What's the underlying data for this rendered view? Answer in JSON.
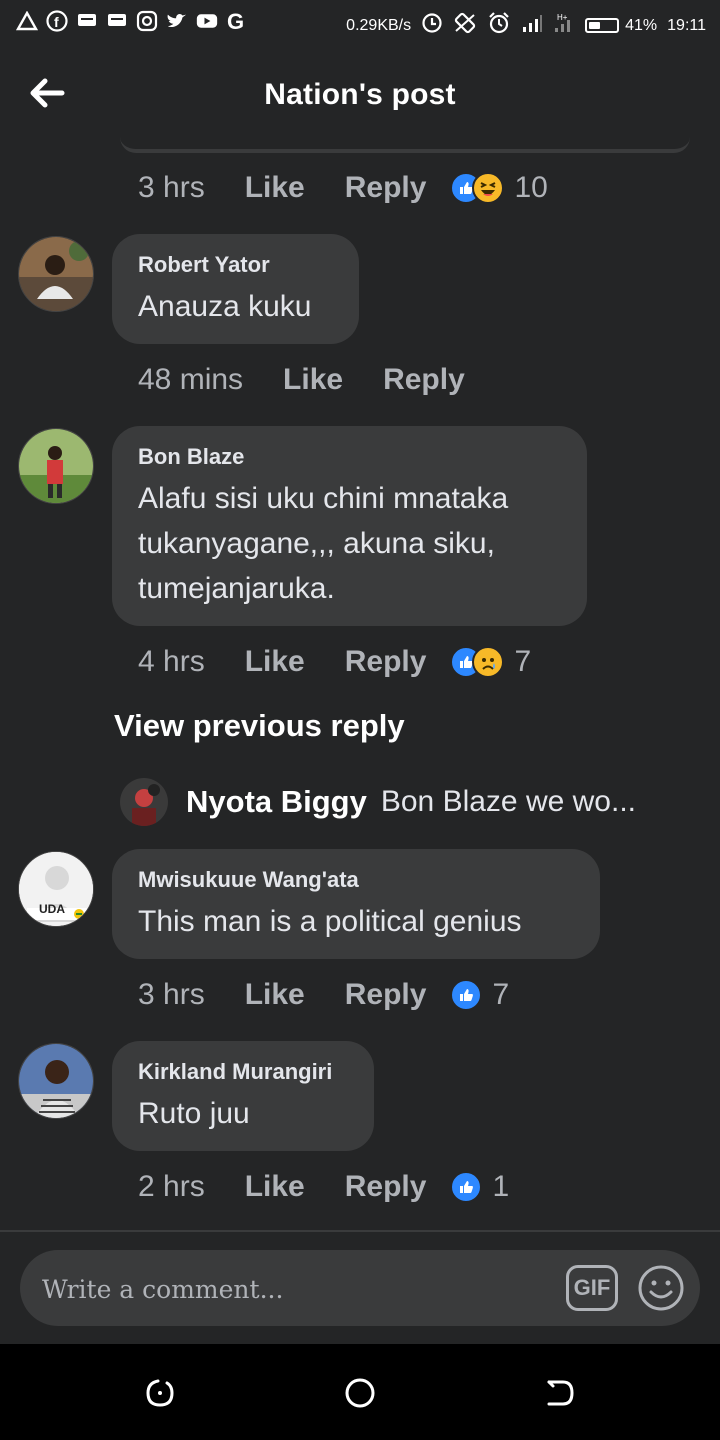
{
  "status_bar": {
    "speed": "0.29KB/s",
    "battery": "41%",
    "battery_fraction": 0.41,
    "time": "19:11",
    "left_icons": [
      "warning-icon",
      "facebook-icon",
      "message-icon",
      "message-icon",
      "instagram-icon",
      "twitter-icon",
      "youtube-icon",
      "google-icon"
    ],
    "right_icons": [
      "data-saver-icon",
      "rotate-icon",
      "alarm-icon",
      "signal-icon",
      "no-sim-signal-icon",
      "battery-icon"
    ]
  },
  "header": {
    "title": "Nation's post"
  },
  "top_comment_meta": {
    "time": "3 hrs",
    "like": "Like",
    "reply": "Reply",
    "reactions": [
      "like",
      "haha"
    ],
    "count": "10"
  },
  "comments": [
    {
      "author": "Robert Yator",
      "text": "Anauza kuku",
      "time": "48 mins",
      "like": "Like",
      "reply": "Reply",
      "reactions": [],
      "count": ""
    },
    {
      "author": "Bon Blaze",
      "text": "Alafu sisi uku chini mnataka\ntukanyagane,,, akuna siku,\ntumejanjaruka.",
      "time": "4 hrs",
      "like": "Like",
      "reply": "Reply",
      "reactions": [
        "like",
        "sad"
      ],
      "count": "7"
    },
    {
      "author": "Mwisukuue Wang'ata",
      "text": "This man is a political genius",
      "time": "3 hrs",
      "like": "Like",
      "reply": "Reply",
      "reactions": [
        "like"
      ],
      "count": "7",
      "avatar_label": "UDA"
    },
    {
      "author": "Kirkland Murangiri",
      "text": "Ruto juu",
      "time": "2 hrs",
      "like": "Like",
      "reply": "Reply",
      "reactions": [
        "like"
      ],
      "count": "1"
    }
  ],
  "view_previous": "View previous reply",
  "reply_preview": {
    "author": "Nyota Biggy",
    "text": "Bon Blaze we wo..."
  },
  "composer": {
    "placeholder": "Write a comment...",
    "gif_label": "GIF"
  },
  "colors": {
    "background": "#242526",
    "bubble": "#3a3b3c",
    "like_blue": "#2d88ff",
    "secondary_text": "#b0b3b8"
  }
}
